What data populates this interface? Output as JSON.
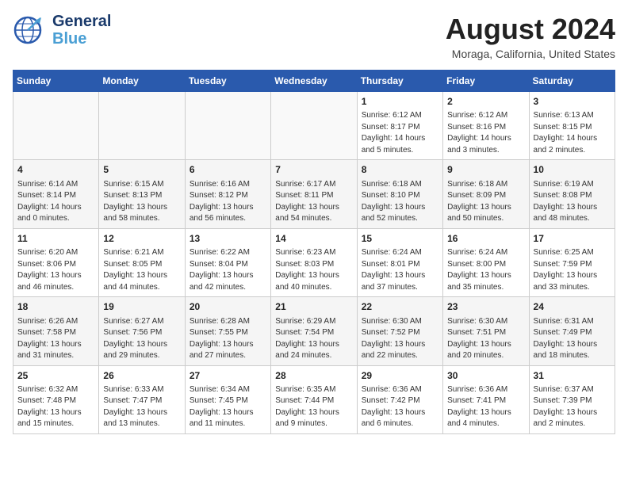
{
  "header": {
    "logo_line1": "General",
    "logo_line2": "Blue",
    "month_year": "August 2024",
    "location": "Moraga, California, United States"
  },
  "days_of_week": [
    "Sunday",
    "Monday",
    "Tuesday",
    "Wednesday",
    "Thursday",
    "Friday",
    "Saturday"
  ],
  "weeks": [
    [
      {
        "day": "",
        "info": ""
      },
      {
        "day": "",
        "info": ""
      },
      {
        "day": "",
        "info": ""
      },
      {
        "day": "",
        "info": ""
      },
      {
        "day": "1",
        "info": "Sunrise: 6:12 AM\nSunset: 8:17 PM\nDaylight: 14 hours\nand 5 minutes."
      },
      {
        "day": "2",
        "info": "Sunrise: 6:12 AM\nSunset: 8:16 PM\nDaylight: 14 hours\nand 3 minutes."
      },
      {
        "day": "3",
        "info": "Sunrise: 6:13 AM\nSunset: 8:15 PM\nDaylight: 14 hours\nand 2 minutes."
      }
    ],
    [
      {
        "day": "4",
        "info": "Sunrise: 6:14 AM\nSunset: 8:14 PM\nDaylight: 14 hours\nand 0 minutes."
      },
      {
        "day": "5",
        "info": "Sunrise: 6:15 AM\nSunset: 8:13 PM\nDaylight: 13 hours\nand 58 minutes."
      },
      {
        "day": "6",
        "info": "Sunrise: 6:16 AM\nSunset: 8:12 PM\nDaylight: 13 hours\nand 56 minutes."
      },
      {
        "day": "7",
        "info": "Sunrise: 6:17 AM\nSunset: 8:11 PM\nDaylight: 13 hours\nand 54 minutes."
      },
      {
        "day": "8",
        "info": "Sunrise: 6:18 AM\nSunset: 8:10 PM\nDaylight: 13 hours\nand 52 minutes."
      },
      {
        "day": "9",
        "info": "Sunrise: 6:18 AM\nSunset: 8:09 PM\nDaylight: 13 hours\nand 50 minutes."
      },
      {
        "day": "10",
        "info": "Sunrise: 6:19 AM\nSunset: 8:08 PM\nDaylight: 13 hours\nand 48 minutes."
      }
    ],
    [
      {
        "day": "11",
        "info": "Sunrise: 6:20 AM\nSunset: 8:06 PM\nDaylight: 13 hours\nand 46 minutes."
      },
      {
        "day": "12",
        "info": "Sunrise: 6:21 AM\nSunset: 8:05 PM\nDaylight: 13 hours\nand 44 minutes."
      },
      {
        "day": "13",
        "info": "Sunrise: 6:22 AM\nSunset: 8:04 PM\nDaylight: 13 hours\nand 42 minutes."
      },
      {
        "day": "14",
        "info": "Sunrise: 6:23 AM\nSunset: 8:03 PM\nDaylight: 13 hours\nand 40 minutes."
      },
      {
        "day": "15",
        "info": "Sunrise: 6:24 AM\nSunset: 8:01 PM\nDaylight: 13 hours\nand 37 minutes."
      },
      {
        "day": "16",
        "info": "Sunrise: 6:24 AM\nSunset: 8:00 PM\nDaylight: 13 hours\nand 35 minutes."
      },
      {
        "day": "17",
        "info": "Sunrise: 6:25 AM\nSunset: 7:59 PM\nDaylight: 13 hours\nand 33 minutes."
      }
    ],
    [
      {
        "day": "18",
        "info": "Sunrise: 6:26 AM\nSunset: 7:58 PM\nDaylight: 13 hours\nand 31 minutes."
      },
      {
        "day": "19",
        "info": "Sunrise: 6:27 AM\nSunset: 7:56 PM\nDaylight: 13 hours\nand 29 minutes."
      },
      {
        "day": "20",
        "info": "Sunrise: 6:28 AM\nSunset: 7:55 PM\nDaylight: 13 hours\nand 27 minutes."
      },
      {
        "day": "21",
        "info": "Sunrise: 6:29 AM\nSunset: 7:54 PM\nDaylight: 13 hours\nand 24 minutes."
      },
      {
        "day": "22",
        "info": "Sunrise: 6:30 AM\nSunset: 7:52 PM\nDaylight: 13 hours\nand 22 minutes."
      },
      {
        "day": "23",
        "info": "Sunrise: 6:30 AM\nSunset: 7:51 PM\nDaylight: 13 hours\nand 20 minutes."
      },
      {
        "day": "24",
        "info": "Sunrise: 6:31 AM\nSunset: 7:49 PM\nDaylight: 13 hours\nand 18 minutes."
      }
    ],
    [
      {
        "day": "25",
        "info": "Sunrise: 6:32 AM\nSunset: 7:48 PM\nDaylight: 13 hours\nand 15 minutes."
      },
      {
        "day": "26",
        "info": "Sunrise: 6:33 AM\nSunset: 7:47 PM\nDaylight: 13 hours\nand 13 minutes."
      },
      {
        "day": "27",
        "info": "Sunrise: 6:34 AM\nSunset: 7:45 PM\nDaylight: 13 hours\nand 11 minutes."
      },
      {
        "day": "28",
        "info": "Sunrise: 6:35 AM\nSunset: 7:44 PM\nDaylight: 13 hours\nand 9 minutes."
      },
      {
        "day": "29",
        "info": "Sunrise: 6:36 AM\nSunset: 7:42 PM\nDaylight: 13 hours\nand 6 minutes."
      },
      {
        "day": "30",
        "info": "Sunrise: 6:36 AM\nSunset: 7:41 PM\nDaylight: 13 hours\nand 4 minutes."
      },
      {
        "day": "31",
        "info": "Sunrise: 6:37 AM\nSunset: 7:39 PM\nDaylight: 13 hours\nand 2 minutes."
      }
    ]
  ]
}
